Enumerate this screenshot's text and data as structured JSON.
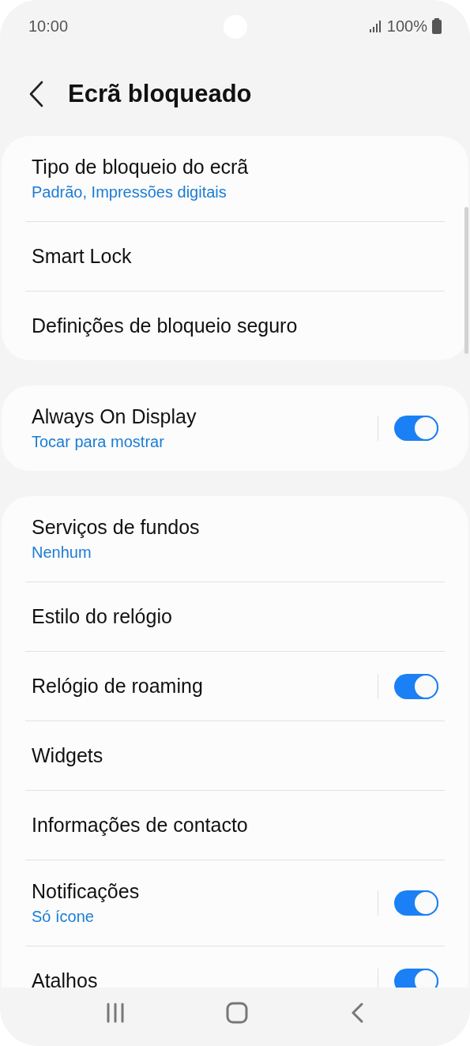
{
  "status_bar": {
    "time": "10:00",
    "battery": "100%"
  },
  "header": {
    "title": "Ecrã bloqueado"
  },
  "sections": [
    {
      "items": [
        {
          "kind": "link",
          "title": "Tipo de bloqueio do ecrã",
          "subtitle": "Padrão, Impressões digitais"
        },
        {
          "kind": "link",
          "title": "Smart Lock"
        },
        {
          "kind": "link",
          "title": "Definições de bloqueio seguro"
        }
      ]
    },
    {
      "items": [
        {
          "kind": "toggle",
          "title": "Always On Display",
          "subtitle": "Tocar para mostrar",
          "on": true
        }
      ]
    },
    {
      "items": [
        {
          "kind": "link",
          "title": "Serviços de fundos",
          "subtitle": "Nenhum"
        },
        {
          "kind": "link",
          "title": "Estilo do relógio"
        },
        {
          "kind": "toggle",
          "title": "Relógio de roaming",
          "on": true
        },
        {
          "kind": "link",
          "title": "Widgets"
        },
        {
          "kind": "link",
          "title": "Informações de contacto"
        },
        {
          "kind": "toggle",
          "title": "Notificações",
          "subtitle": "Só ícone",
          "on": true
        },
        {
          "kind": "toggle",
          "title": "Atalhos",
          "on": true
        }
      ]
    }
  ]
}
